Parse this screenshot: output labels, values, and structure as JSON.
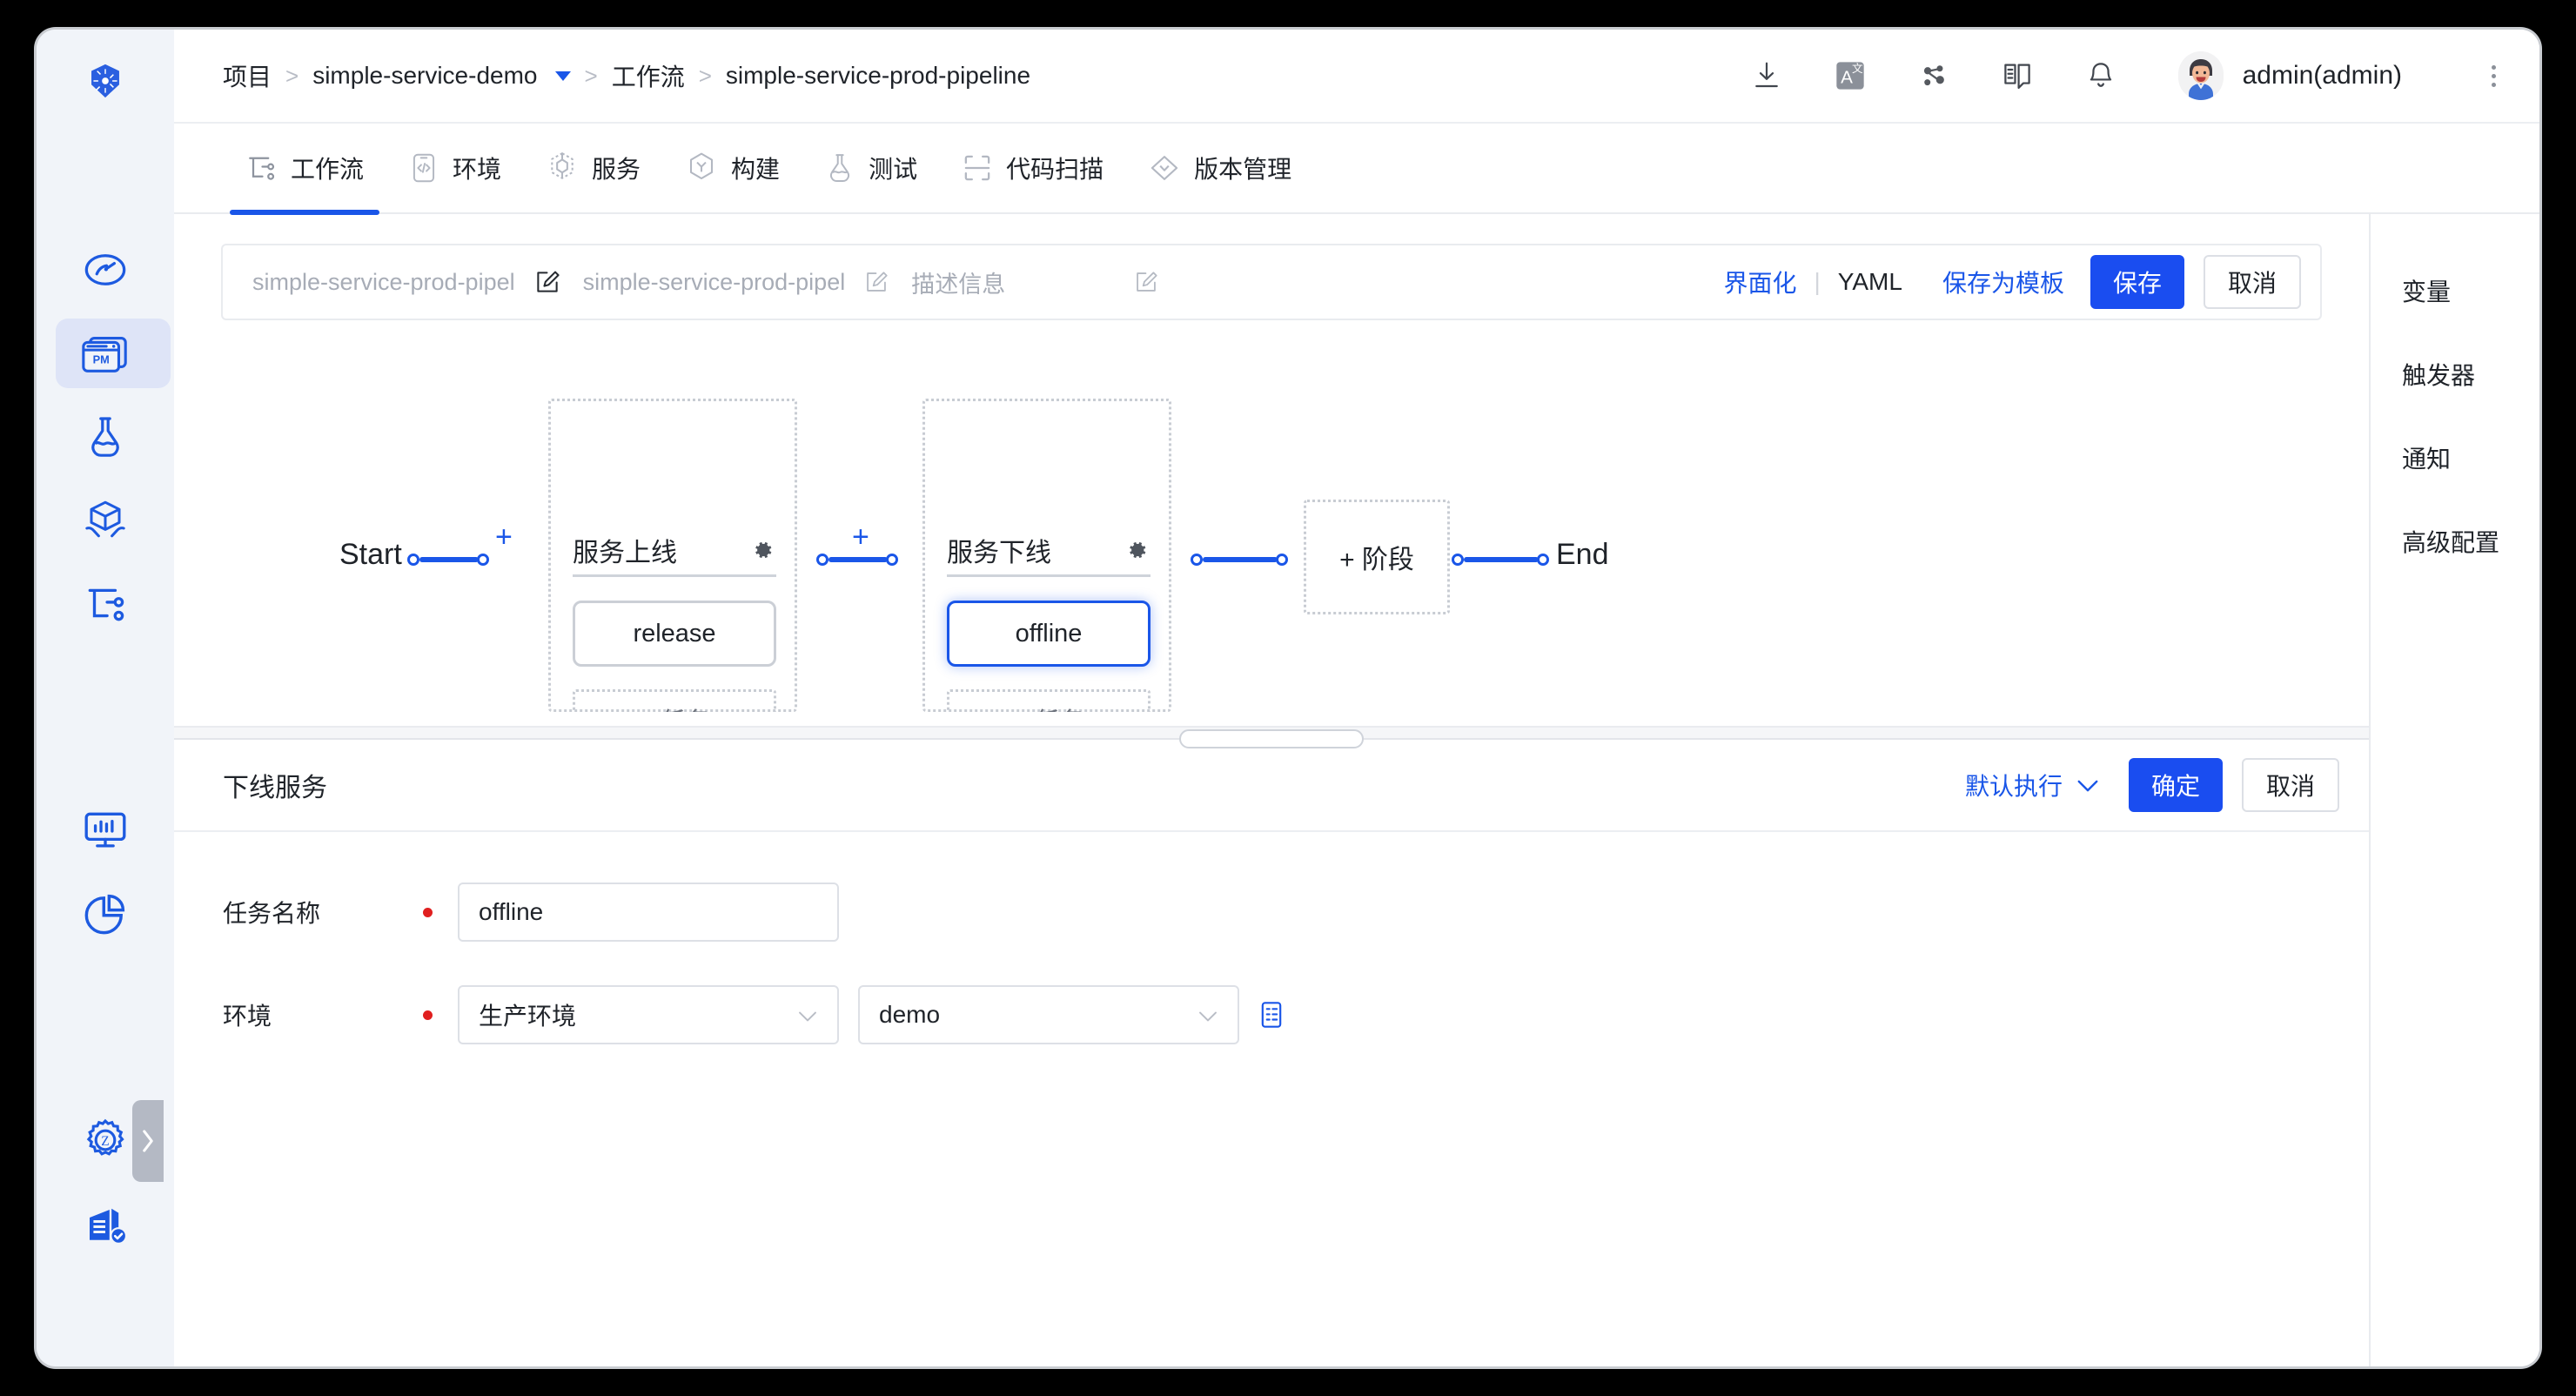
{
  "app": {
    "accent": "#1a4df0",
    "accent_text": "#1a56e8",
    "rail_bg": "#f1f4f9"
  },
  "rail": {
    "items": [
      {
        "name": "kubernetes-logo-icon",
        "label": "Kubernetes",
        "active": false
      },
      {
        "name": "dashboard-gauge-icon",
        "label": "Dashboard",
        "active": false
      },
      {
        "name": "project-management-pm-icon",
        "label": "PM",
        "active": true
      },
      {
        "name": "flask-test-icon",
        "label": "Test",
        "active": false
      },
      {
        "name": "package-delivery-icon",
        "label": "Delivery",
        "active": false
      },
      {
        "name": "workflow-tree-icon",
        "label": "Workflow",
        "active": false
      },
      {
        "name": "monitor-chart-icon",
        "label": "Monitor",
        "active": false
      },
      {
        "name": "pie-chart-icon",
        "label": "Statistics",
        "active": false
      },
      {
        "name": "gear-z-settings-icon",
        "label": "Settings",
        "active": false
      },
      {
        "name": "enterprise-verified-icon",
        "label": "Enterprise",
        "active": false
      }
    ],
    "collapse_label": "›"
  },
  "header": {
    "breadcrumb": {
      "root": "项目",
      "sep": ">",
      "project": "simple-service-demo",
      "section": "工作流",
      "current": "simple-service-prod-pipeline"
    },
    "icons": [
      {
        "name": "download-icon"
      },
      {
        "name": "translate-language-icon"
      },
      {
        "name": "share-nodes-icon"
      },
      {
        "name": "docs-book-icon"
      },
      {
        "name": "bell-notification-icon"
      }
    ],
    "user": "admin(admin)",
    "avatar_name": "user-avatar"
  },
  "navtabs": [
    {
      "label": "工作流",
      "icon": "workflow-tree-icon",
      "active": true
    },
    {
      "label": "环境",
      "icon": "code-brackets-icon",
      "active": false
    },
    {
      "label": "服务",
      "icon": "service-node-icon",
      "active": false
    },
    {
      "label": "构建",
      "icon": "build-hexagon-icon",
      "active": false
    },
    {
      "label": "测试",
      "icon": "flask-test-icon",
      "active": false
    },
    {
      "label": "代码扫描",
      "icon": "scan-frame-icon",
      "active": false
    },
    {
      "label": "版本管理",
      "icon": "version-diamond-icon",
      "active": false
    }
  ],
  "canvas_toolbar": {
    "pipeline_name_placeholder": "simple-service-prod-pipel",
    "pipeline_display_placeholder": "simple-service-prod-pipel",
    "description_placeholder": "描述信息",
    "view_ui": "界面化",
    "view_divider": "|",
    "view_yaml": "YAML",
    "save_as_template": "保存为模板",
    "save": "保存",
    "cancel": "取消"
  },
  "flow": {
    "start_label": "Start",
    "end_label": "End",
    "plus_label": "+",
    "add_stage_label": "+ 阶段",
    "stages": [
      {
        "title": "服务上线",
        "gear": "gear-icon",
        "tasks": [
          {
            "label": "release",
            "selected": false
          }
        ],
        "add_task_label": "+ 任务"
      },
      {
        "title": "服务下线",
        "gear": "gear-icon",
        "tasks": [
          {
            "label": "offline",
            "selected": true
          }
        ],
        "add_task_label": "+ 任务"
      }
    ]
  },
  "detail": {
    "title": "下线服务",
    "exec_mode": "默认执行",
    "confirm": "确定",
    "cancel": "取消",
    "fields": [
      {
        "label": "任务名称",
        "required": true,
        "type": "input",
        "value": "offline",
        "name": "task-name-input"
      },
      {
        "label": "环境",
        "required": true,
        "type": "select-pair",
        "value": "生产环境",
        "value2": "demo",
        "name": "environment-select",
        "name2": "environment-service-select",
        "extra_icon": "service-list-icon"
      }
    ]
  },
  "right_panel": {
    "items": [
      {
        "label": "变量",
        "name": "right-panel-variables"
      },
      {
        "label": "触发器",
        "name": "right-panel-triggers"
      },
      {
        "label": "通知",
        "name": "right-panel-notifications"
      },
      {
        "label": "高级配置",
        "name": "right-panel-advanced"
      }
    ]
  }
}
